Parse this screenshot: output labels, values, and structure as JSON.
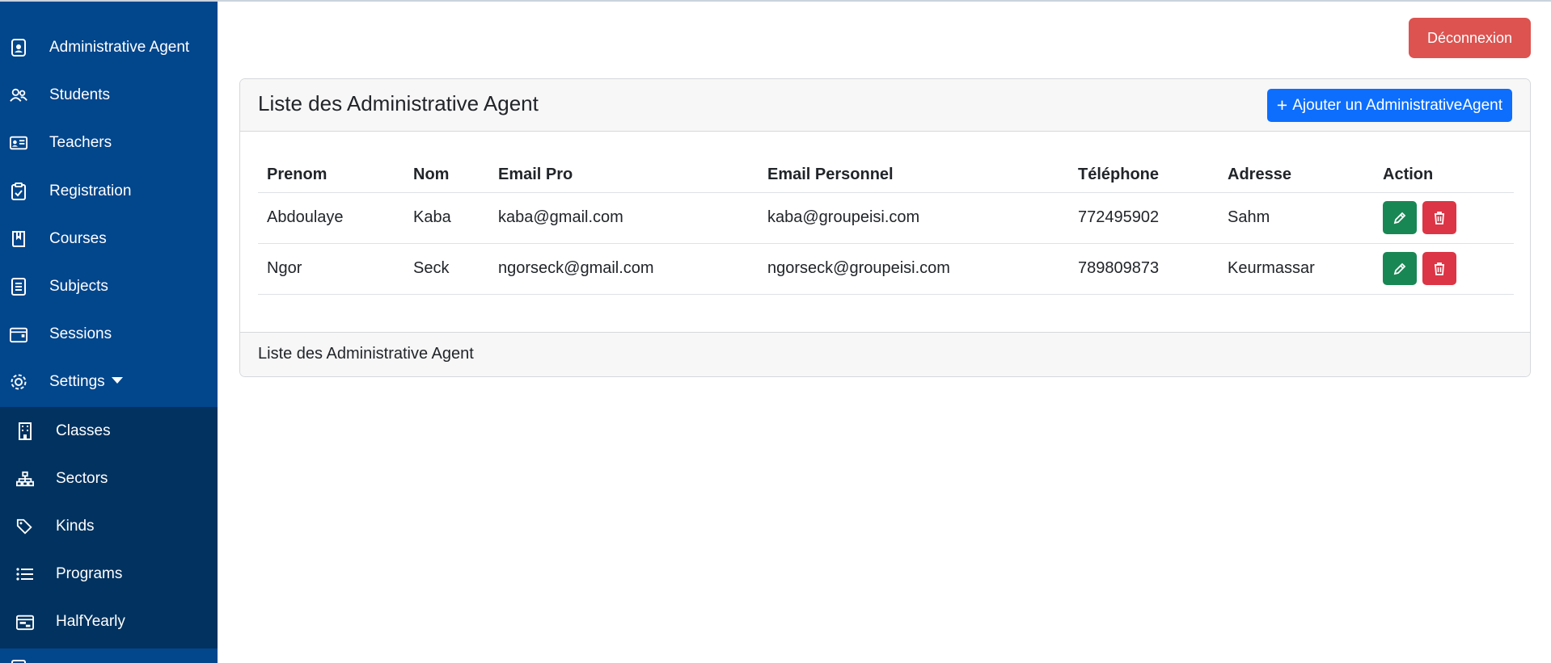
{
  "sidebar": {
    "items": [
      {
        "label": "Administrative Agent",
        "icon": "badge-icon"
      },
      {
        "label": "Students",
        "icon": "people-icon"
      },
      {
        "label": "Teachers",
        "icon": "id-card-icon"
      },
      {
        "label": "Registration",
        "icon": "clipboard-check-icon"
      },
      {
        "label": "Courses",
        "icon": "book-icon"
      },
      {
        "label": "Subjects",
        "icon": "list-doc-icon"
      },
      {
        "label": "Sessions",
        "icon": "calendar-icon"
      },
      {
        "label": "Settings",
        "icon": "gear-icon"
      }
    ],
    "submenu": [
      {
        "label": "Classes",
        "icon": "building-icon"
      },
      {
        "label": "Sectors",
        "icon": "diagram-icon"
      },
      {
        "label": "Kinds",
        "icon": "tags-icon"
      },
      {
        "label": "Programs",
        "icon": "list-icon"
      },
      {
        "label": "HalfYearly",
        "icon": "calendar-range-icon"
      }
    ]
  },
  "header": {
    "logout_label": "Déconnexion"
  },
  "card": {
    "title": "Liste des Administrative Agent",
    "add_button_label": "Ajouter un AdministrativeAgent",
    "footer": "Liste des Administrative Agent"
  },
  "table": {
    "columns": [
      "Prenom",
      "Nom",
      "Email Pro",
      "Email Personnel",
      "Téléphone",
      "Adresse",
      "Action"
    ],
    "rows": [
      {
        "prenom": "Abdoulaye",
        "nom": "Kaba",
        "email_pro": "kaba@gmail.com",
        "email_perso": "kaba@groupeisi.com",
        "telephone": "772495902",
        "adresse": "Sahm"
      },
      {
        "prenom": "Ngor",
        "nom": "Seck",
        "email_pro": "ngorseck@gmail.com",
        "email_perso": "ngorseck@groupeisi.com",
        "telephone": "789809873",
        "adresse": "Keurmassar"
      }
    ]
  },
  "colors": {
    "sidebar": "#02468c",
    "submenu": "#02325f",
    "primary": "#0d6efd",
    "success": "#198754",
    "danger": "#dc3545",
    "logout": "#dc5350"
  }
}
